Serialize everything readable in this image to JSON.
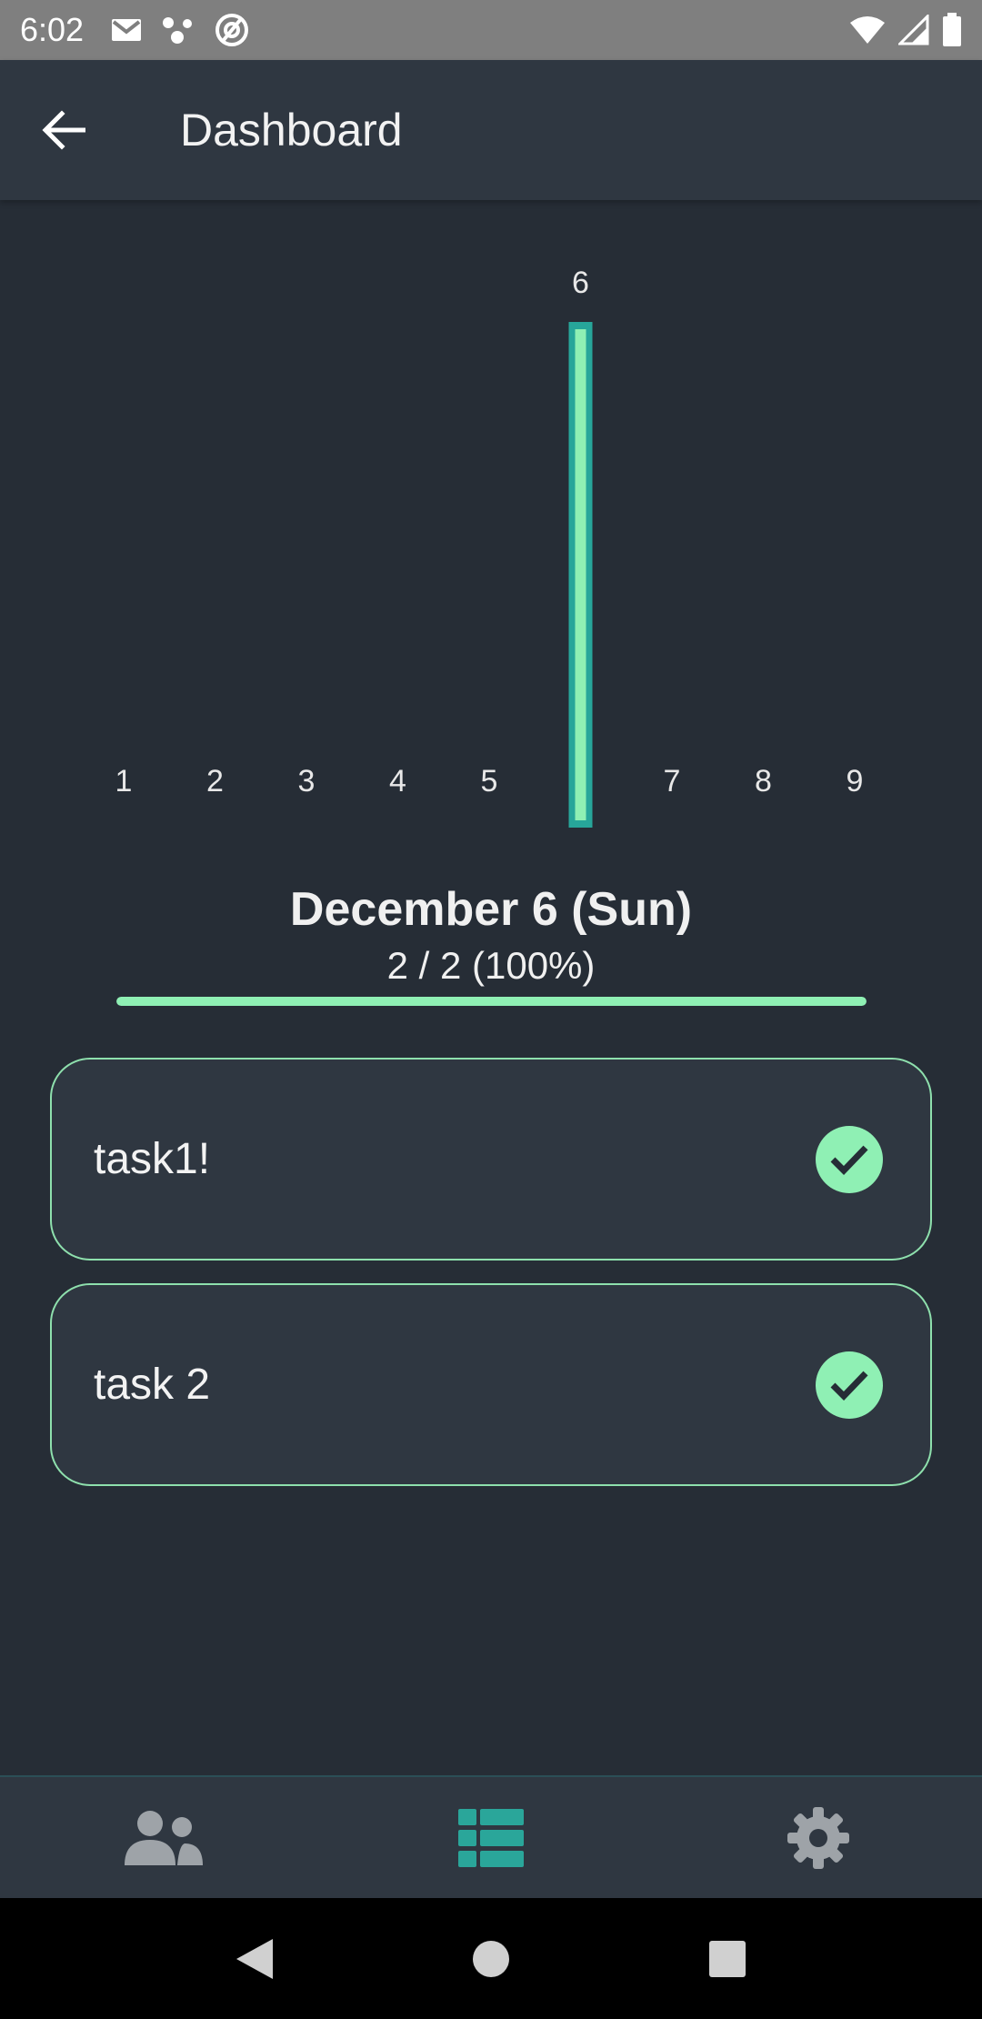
{
  "status_bar": {
    "time": "6:02",
    "left_icons": [
      "gmail-icon",
      "nodes-icon",
      "at-sign-icon"
    ],
    "right_icons": [
      "wifi-icon",
      "cell-signal-icon",
      "battery-icon"
    ]
  },
  "app_bar": {
    "title": "Dashboard",
    "back_icon": "arrow-back-icon"
  },
  "chart_data": {
    "type": "bar",
    "categories": [
      "1",
      "2",
      "3",
      "4",
      "5",
      "6",
      "7",
      "8",
      "9"
    ],
    "selected_index": 5,
    "selected_label": "6",
    "bar_color": "#8ff0b4",
    "bar_outline_color": "#27a69a"
  },
  "day": {
    "title": "December 6 (Sun)",
    "progress_text": "2 / 2 (100%)",
    "progress_fraction": 1.0
  },
  "tasks": [
    {
      "label": "task1!",
      "done": true
    },
    {
      "label": "task 2",
      "done": true
    }
  ],
  "bottom_nav": {
    "items": [
      {
        "icon": "users-icon",
        "active": false
      },
      {
        "icon": "list-icon",
        "active": true
      },
      {
        "icon": "gear-icon",
        "active": false
      }
    ]
  },
  "colors": {
    "accent": "#8ff0b4",
    "active_nav": "#2aa69a",
    "inactive_nav": "#9ea3a8",
    "background": "#262d36",
    "surface": "#2f3741"
  }
}
